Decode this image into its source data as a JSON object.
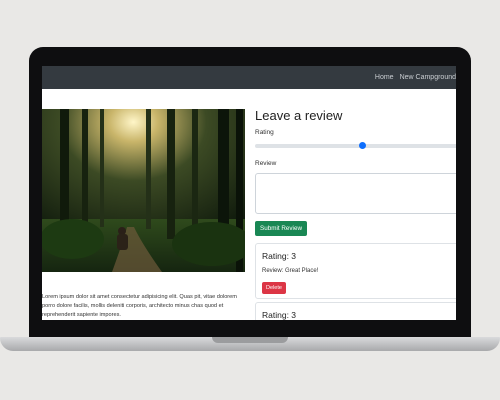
{
  "nav": {
    "links": [
      "Home",
      "New Campground"
    ]
  },
  "campground": {
    "description": "Lorem ipsum dolor sit amet consectetur adipisicing elit. Quas pit, vitae dolorem porro dolore facilis, mollis deleniti corporis, architecto minus chas quod et reprehenderit sapiente impores."
  },
  "review_form": {
    "title": "Leave a review",
    "rating_label": "Rating",
    "rating_value": 3,
    "rating_max": 5,
    "review_label": "Review",
    "review_value": "",
    "submit_label": "Submit Review"
  },
  "reviews": [
    {
      "rating_text": "Rating: 3",
      "text": "Review: Great Place!",
      "delete_label": "Delete"
    },
    {
      "rating_text": "Rating: 3"
    }
  ],
  "colors": {
    "navbar": "#343a40",
    "submit": "#198754",
    "delete": "#dc3545",
    "slider": "#0d6efd"
  }
}
